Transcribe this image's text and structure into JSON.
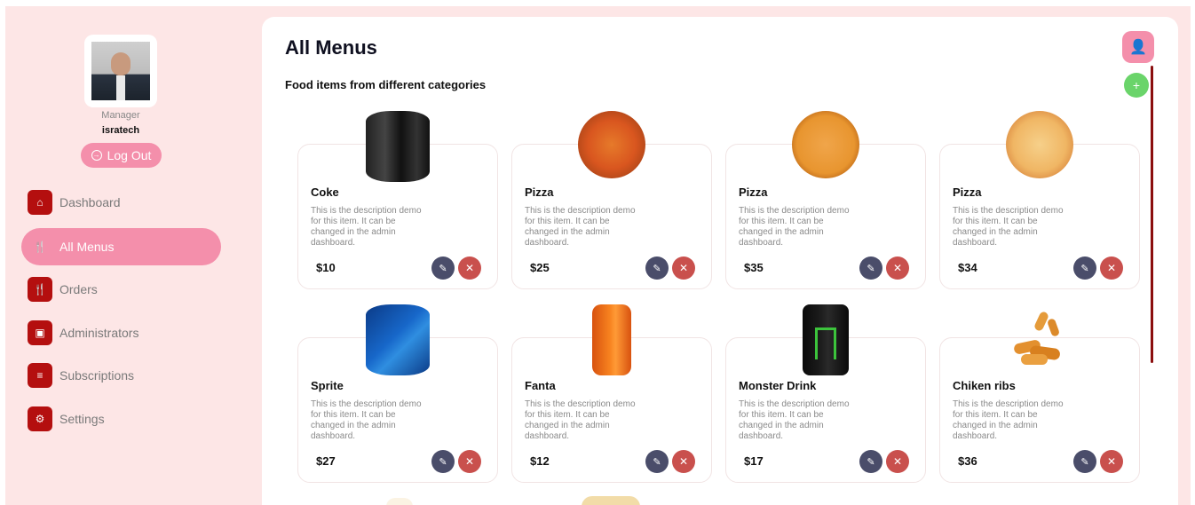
{
  "profile": {
    "role": "Manager",
    "username": "isratech",
    "logout_label": "Log Out"
  },
  "nav": [
    {
      "label": "Dashboard",
      "icon": "home-icon",
      "active": false
    },
    {
      "label": "All Menus",
      "icon": "utensils-icon",
      "active": true
    },
    {
      "label": "Orders",
      "icon": "utensils-icon",
      "active": false
    },
    {
      "label": "Administrators",
      "icon": "id-card-icon",
      "active": false
    },
    {
      "label": "Subscriptions",
      "icon": "list-icon",
      "active": false
    },
    {
      "label": "Settings",
      "icon": "gear-icon",
      "active": false
    }
  ],
  "main": {
    "title": "All Menus",
    "subtitle": "Food items from different categories"
  },
  "colors": {
    "accent": "#f48fab",
    "nav_icon": "#b40f0f",
    "add": "#6ad46a",
    "edit": "#4a4d6a",
    "delete": "#c9504d"
  },
  "items": [
    {
      "name": "Coke",
      "desc": "This is the description demo for this item. It can be changed in the admin dashboard.",
      "price": "$10",
      "image": "coke-can"
    },
    {
      "name": "Pizza",
      "desc": "This is the description demo for this item. It can be changed in the admin dashboard.",
      "price": "$25",
      "image": "pizza-veggie"
    },
    {
      "name": "Pizza",
      "desc": "This is the description demo for this item. It can be changed in the admin dashboard.",
      "price": "$35",
      "image": "pizza-cheese"
    },
    {
      "name": "Pizza",
      "desc": "This is the description demo for this item. It can be changed in the admin dashboard.",
      "price": "$34",
      "image": "pizza-light"
    },
    {
      "name": "Sprite",
      "desc": "This is the description demo for this item. It can be changed in the admin dashboard.",
      "price": "$27",
      "image": "sprite-can"
    },
    {
      "name": "Fanta",
      "desc": "This is the description demo for this item. It can be changed in the admin dashboard.",
      "price": "$12",
      "image": "fanta-can"
    },
    {
      "name": "Monster Drink",
      "desc": "This is the description demo for this item. It can be changed in the admin dashboard.",
      "price": "$17",
      "image": "monster-can"
    },
    {
      "name": "Chiken ribs",
      "desc": "This is the description demo for this item. It can be changed in the admin dashboard.",
      "price": "$36",
      "image": "chicken"
    }
  ]
}
